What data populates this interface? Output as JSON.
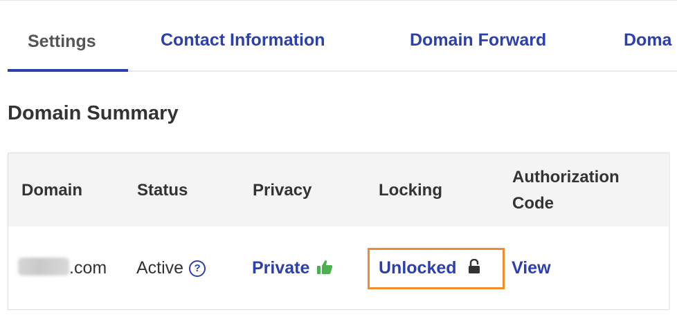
{
  "tabs": [
    {
      "label": "Settings",
      "active": true
    },
    {
      "label": "Contact Information",
      "active": false
    },
    {
      "label": "Domain Forward",
      "active": false
    },
    {
      "label": "Doma",
      "active": false
    }
  ],
  "section": {
    "title": "Domain Summary"
  },
  "table": {
    "headers": {
      "domain": "Domain",
      "status": "Status",
      "privacy": "Privacy",
      "locking": "Locking",
      "authorization_code": "Authorization Code"
    },
    "row": {
      "domain_suffix": ".com",
      "status": "Active",
      "status_help_icon": "?",
      "privacy": "Private",
      "privacy_icon": "thumbs-up-icon",
      "locking": "Unlocked",
      "locking_icon": "unlocked-padlock-icon",
      "authorization_code": "View"
    }
  },
  "colors": {
    "accent_blue": "#2b3fae",
    "highlight_orange": "#f28b2c",
    "thumb_green": "#4caf50",
    "header_bg": "#f4f4f4"
  }
}
